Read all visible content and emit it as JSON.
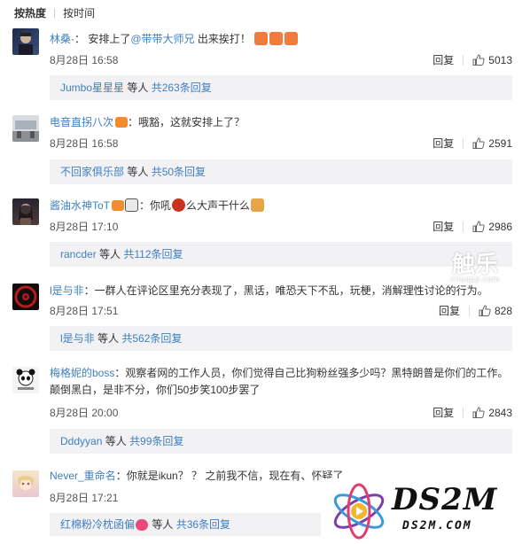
{
  "sort_tabs": {
    "hot": "按热度",
    "time": "按时间"
  },
  "reply_label": "回复",
  "comments": [
    {
      "username": "林桑",
      "username_suffix": "·：",
      "text_before": "安排上了",
      "mention": "@带带大师兄",
      "text_after": " 出来挨打！",
      "date": "8月28日 16:58",
      "likes": "5013",
      "reply_user": "Jumbo星星星",
      "reply_mid": " 等人 ",
      "reply_count": "共263条回复"
    },
    {
      "username": "电音直拐八次",
      "text": "哦豁，这就安排上了？",
      "date": "8月28日 16:58",
      "likes": "2591",
      "reply_user": "不回家俱乐部",
      "reply_mid": " 等人 ",
      "reply_count": "共50条回复"
    },
    {
      "username": "酱油水神ToT",
      "text_before": "：你吼",
      "text_after": "么大声干什么",
      "date": "8月28日 17:10",
      "likes": "2986",
      "reply_user": "rancder",
      "reply_mid": " 等人 ",
      "reply_count": "共112条回复"
    },
    {
      "username": "l是与非",
      "text": "：一群人在评论区里充分表现了，黑话，唯恐天下不乱，玩梗，消解理性讨论的行为。",
      "date": "8月28日 17:51",
      "likes": "828",
      "reply_user": "l是与非",
      "reply_mid": " 等人 ",
      "reply_count": "共562条回复"
    },
    {
      "username": "梅格妮的boss",
      "text": "：观察者网的工作人员，你们觉得自己比狗粉丝强多少吗？黑特朗普是你们的工作。",
      "text_line2": "颠倒黑白，是非不分，你们50步笑100步罢了",
      "date": "8月28日 20:00",
      "likes": "2843",
      "reply_user": "Dddyyan",
      "reply_mid": " 等人 ",
      "reply_count": "共99条回复"
    },
    {
      "username": "Never_重命名",
      "text": "：你就是ikun？ ？ 之前我不信，现在有、怀疑了",
      "date": "8月28日 17:21",
      "reply_user": "红棉粉冷枕函偏",
      "reply_mid": " 等人 ",
      "reply_count": "共36条回复"
    }
  ],
  "watermark_chu": {
    "main": "触乐",
    "sub": "chuapp.com"
  },
  "watermark_ds2m": {
    "main": "DS2M",
    "sub": "DS2M.COM"
  },
  "colors": {
    "username": "#eb7350",
    "link": "#3f7fbf",
    "reply_bg": "#f2f2f5"
  }
}
